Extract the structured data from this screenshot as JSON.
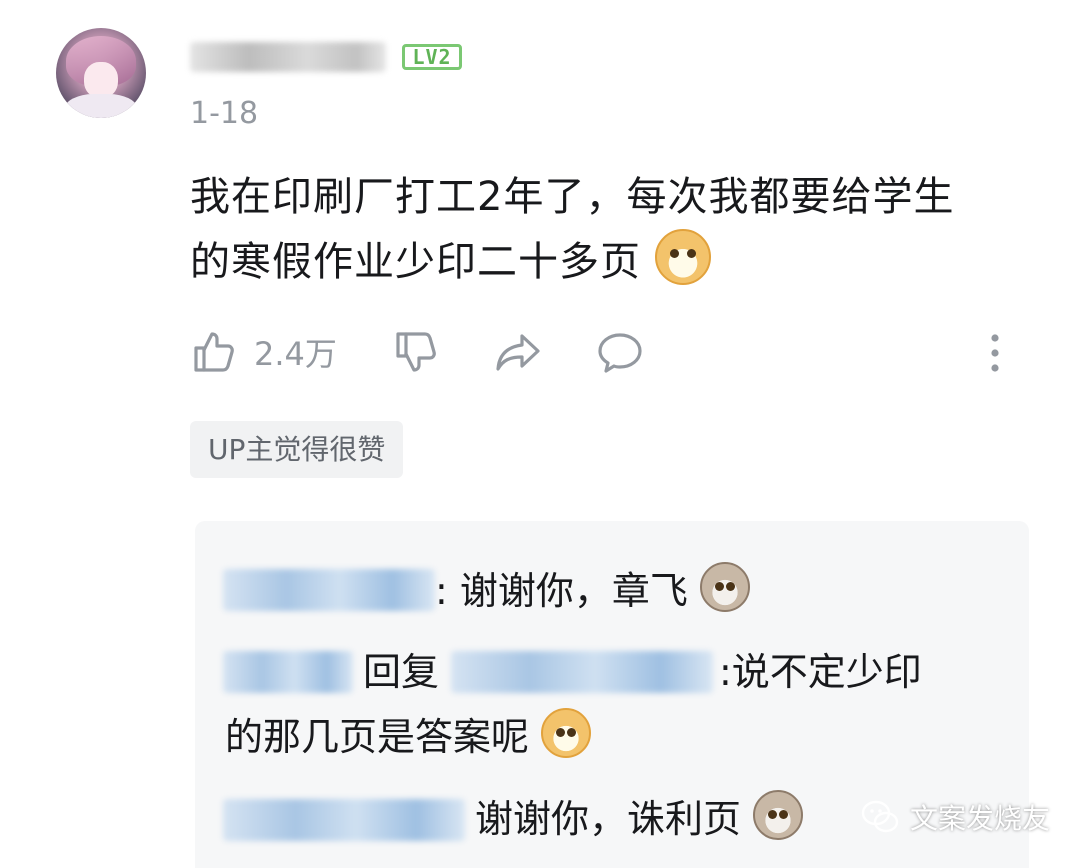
{
  "comment": {
    "level_badge": "LV2",
    "date": "1-18",
    "text_line1": "我在印刷厂打工2年了，每次我都要给学生",
    "text_line2": "的寒假作业少印二十多页",
    "like_count": "2.4万",
    "up_tag": "UP主觉得很赞"
  },
  "replies": [
    {
      "text": ": 谢谢你，章飞",
      "emoji": "doge-gray-icon"
    },
    {
      "reply_word": "回复",
      "text_part1": ":说不定少印",
      "text_part2": "的那几页是答案呢",
      "emoji": "doge-icon"
    },
    {
      "text": "谢谢你，诛利页",
      "emoji": "doge-gray-icon"
    }
  ],
  "watermark": {
    "label": "文案发烧友"
  },
  "colors": {
    "level": "#7bc873",
    "secondary_text": "#9499a0",
    "reply_bg": "#f6f7f8"
  }
}
